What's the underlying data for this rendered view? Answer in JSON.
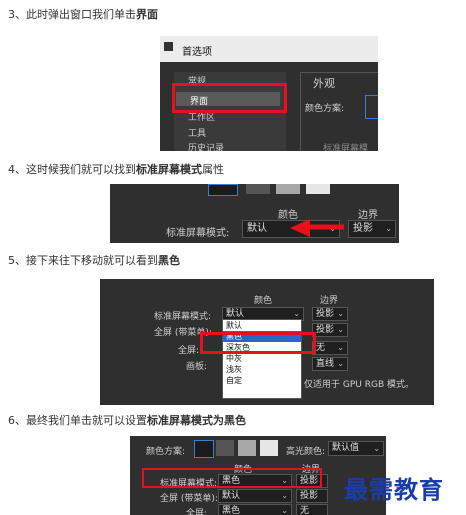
{
  "steps": [
    {
      "num": "3、",
      "pre": "此时弹出窗口我们单击",
      "bold": "界面",
      "post": ""
    },
    {
      "num": "4、",
      "pre": "这时候我们就可以找到",
      "bold": "标准屏幕模式",
      "post": "属性"
    },
    {
      "num": "5、",
      "pre": "接下来往下移动就可以看到",
      "bold": "黑色",
      "post": ""
    },
    {
      "num": "6、",
      "pre": "最终我们单击就可以设置",
      "bold": "标准屏幕模式为黑色",
      "post": ""
    }
  ],
  "shot1": {
    "title": "首选项",
    "menu": [
      "常规",
      "界面",
      "工作区",
      "工具",
      "历史记录"
    ],
    "section": "外观",
    "color_scheme": "颜色方案:",
    "cut_label": "标准屏幕模"
  },
  "shot2": {
    "col_color": "颜色",
    "col_border": "边界",
    "label": "标准屏幕模式:",
    "value": "默认",
    "border_value": "投影"
  },
  "shot3": {
    "col_color": "颜色",
    "col_border": "边界",
    "rows": [
      {
        "label": "标准屏幕模式:",
        "value": "默认",
        "border": "投影"
      },
      {
        "label": "全屏 (带菜单):",
        "value": "",
        "border": "投影"
      },
      {
        "label": "全屏:",
        "value": "",
        "border": "无"
      },
      {
        "label": "画板:",
        "value": "",
        "border": "直线"
      }
    ],
    "options": [
      "默认",
      "黑色",
      "深灰色",
      "中灰",
      "浅灰",
      "自定"
    ],
    "selected_index": 1,
    "note": "仅适用于 GPU RGB 模式。"
  },
  "shot4": {
    "color_scheme": "颜色方案:",
    "highlight": "高光颜色:",
    "highlight_value": "默认值",
    "col_color": "颜色",
    "col_border": "边界",
    "rows": [
      {
        "label": "标准屏幕模式:",
        "value": "黑色",
        "border": "投影"
      },
      {
        "label": "全屏 (带菜单):",
        "value": "默认",
        "border": "投影"
      },
      {
        "label": "全屏:",
        "value": "黑色",
        "border": "无"
      }
    ]
  },
  "watermark": "最需教育",
  "colors": {
    "accent_red": "#e8101b",
    "dark_bg": "#2f2f2f",
    "select_blue": "#2e63c9",
    "arrow_red": "#e8101b"
  }
}
